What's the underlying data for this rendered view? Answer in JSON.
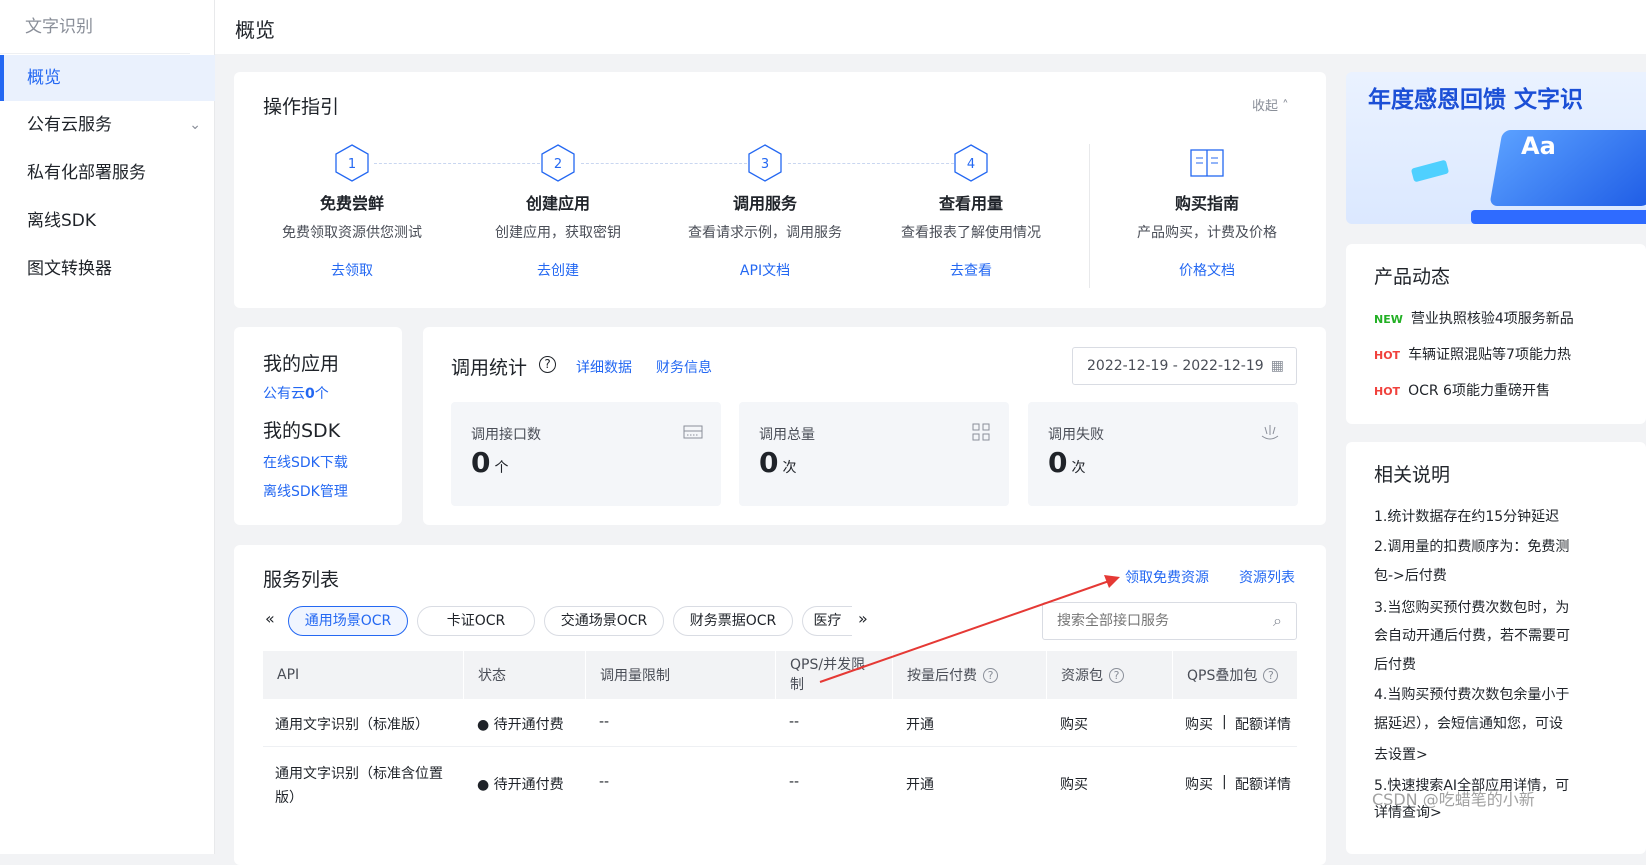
{
  "sidebar": {
    "title": "文字识别",
    "items": [
      {
        "label": "概览",
        "active": true
      },
      {
        "label": "公有云服务",
        "has_children": true
      },
      {
        "label": "私有化部署服务"
      },
      {
        "label": "离线SDK"
      },
      {
        "label": "图文转换器"
      }
    ]
  },
  "header": {
    "title": "概览"
  },
  "guide": {
    "title": "操作指引",
    "collapse_label": "收起",
    "steps": [
      {
        "num": "1",
        "name": "免费尝鲜",
        "desc": "免费领取资源供您测试",
        "link": "去领取"
      },
      {
        "num": "2",
        "name": "创建应用",
        "desc": "创建应用，获取密钥",
        "link": "去创建"
      },
      {
        "num": "3",
        "name": "调用服务",
        "desc": "查看请求示例，调用服务",
        "link": "API文档"
      },
      {
        "num": "4",
        "name": "查看用量",
        "desc": "查看报表了解使用情况",
        "link": "去查看"
      }
    ],
    "buy": {
      "name": "购买指南",
      "desc": "产品购买，计费及价格",
      "link": "价格文档"
    }
  },
  "apps": {
    "title": "我的应用",
    "public_cloud_prefix": "公有云",
    "public_cloud_count": "0",
    "public_cloud_suffix": "个",
    "sdk_title": "我的SDK",
    "sdk_online": "在线SDK下载",
    "sdk_offline": "离线SDK管理"
  },
  "stats": {
    "title": "调用统计",
    "help": "?",
    "detail_link": "详细数据",
    "finance_link": "财务信息",
    "date_range": "2022-12-19 - 2022-12-19",
    "cards": [
      {
        "label": "调用接口数",
        "value": "0",
        "unit": "个",
        "icon": "api-icon"
      },
      {
        "label": "调用总量",
        "value": "0",
        "unit": "次",
        "icon": "grid-icon"
      },
      {
        "label": "调用失败",
        "value": "0",
        "unit": "次",
        "icon": "fail-icon"
      }
    ]
  },
  "services": {
    "title": "服务列表",
    "free_link": "领取免费资源",
    "resource_link": "资源列表",
    "search_placeholder": "搜索全部接口服务",
    "tabs": [
      "通用场景OCR",
      "卡证OCR",
      "交通场景OCR",
      "财务票据OCR",
      "医疗"
    ],
    "columns": [
      "API",
      "状态",
      "调用量限制",
      "QPS/并发限制",
      "按量后付费",
      "资源包",
      "QPS叠加包"
    ],
    "rows": [
      {
        "api": "通用文字识别（标准版）",
        "status": "待开通付费",
        "limit": "--",
        "qps": "--",
        "postpaid": "开通",
        "pkg": "购买",
        "qps_buy": "购买",
        "qps_detail": "配额详情"
      },
      {
        "api": "通用文字识别（标准含位置版）",
        "status": "待开通付费",
        "limit": "--",
        "qps": "--",
        "postpaid": "开通",
        "pkg": "购买",
        "qps_buy": "购买",
        "qps_detail": "配额详情"
      }
    ]
  },
  "banner": {
    "text": "年度感恩回馈 文字识",
    "badge": "Aa"
  },
  "news": {
    "title": "产品动态",
    "items": [
      {
        "tag": "NEW",
        "tag_color": "#23b025",
        "text": "营业执照核验4项服务新品"
      },
      {
        "tag": "HOT",
        "tag_color": "#f0413c",
        "text": "车辆证照混贴等7项能力热"
      },
      {
        "tag": "HOT",
        "tag_color": "#f0413c",
        "text": "OCR 6项能力重磅开售"
      }
    ]
  },
  "notes": {
    "title": "相关说明",
    "lines": [
      "1.统计数据存在约15分钟延迟",
      "2.调用量的扣费顺序为：免费测",
      "包->后付费",
      "3.当您购买预付费次数包时，为",
      "会自动开通后付费，若不需要可",
      "后付费",
      "4.当购买预付费次数包余量小于",
      "据延迟），会短信通知您，可设"
    ],
    "setting_link": "去设置>",
    "line5": "5.快速搜索AI全部应用详情，可",
    "detail_link": "详情查询>"
  },
  "watermark": "CSDN @吃蜡笔的小新"
}
